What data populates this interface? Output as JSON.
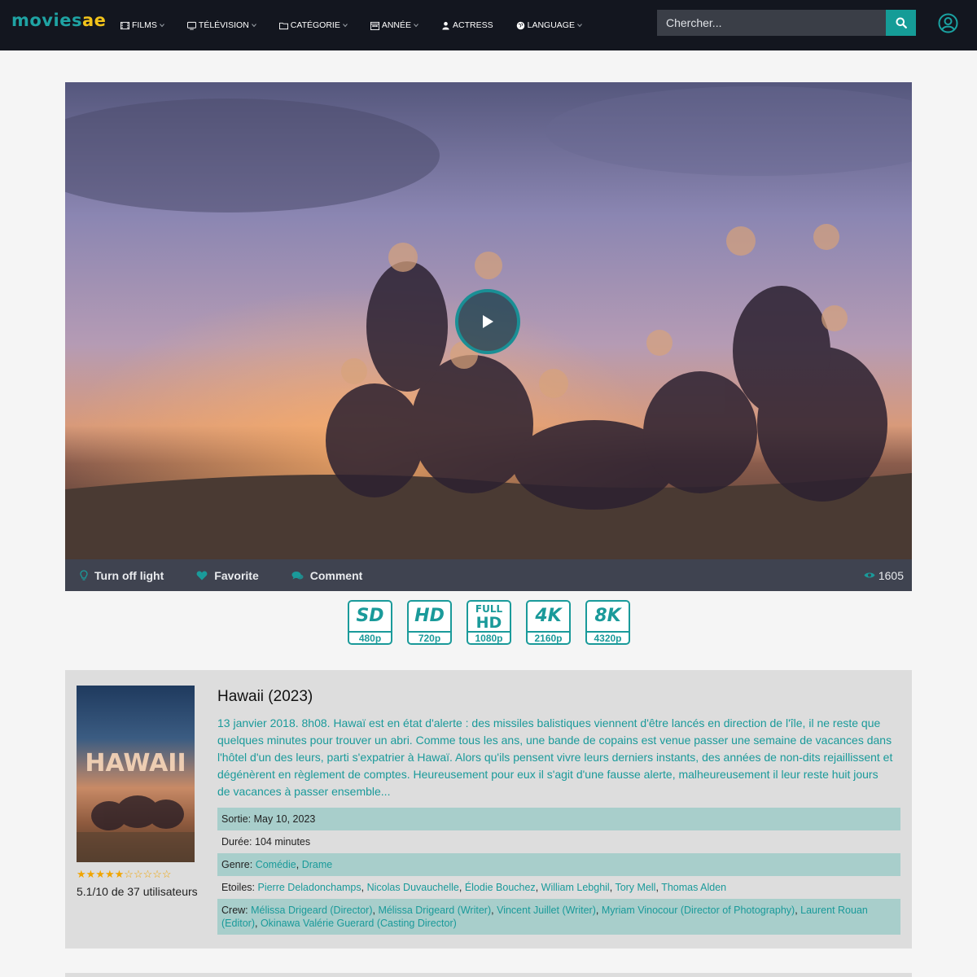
{
  "header": {
    "logo_part1": "movies",
    "logo_part2": "ae",
    "nav": [
      {
        "label": "Films",
        "icon": "film-icon"
      },
      {
        "label": "Télévision",
        "icon": "tv-icon"
      },
      {
        "label": "Catégorie",
        "icon": "folder-icon"
      },
      {
        "label": "Année",
        "icon": "calendar-icon"
      },
      {
        "label": "Actress",
        "icon": "user-icon"
      },
      {
        "label": "Language",
        "icon": "globe-icon"
      }
    ],
    "search_placeholder": "Chercher...",
    "accent": "#159c97"
  },
  "player": {
    "controls": {
      "light": "Turn off light",
      "favorite": "Favorite",
      "comment": "Comment"
    },
    "views": "1605"
  },
  "quality": [
    {
      "top": "SD",
      "res": "480p"
    },
    {
      "top": "HD",
      "res": "720p"
    },
    {
      "top_line1": "FULL",
      "top_line2": "HD",
      "res": "1080p"
    },
    {
      "top": "4K",
      "res": "2160p"
    },
    {
      "top": "8K",
      "res": "4320p"
    }
  ],
  "movie": {
    "poster_text": "HAWAII",
    "title": "Hawaii (2023)",
    "description": "13 janvier 2018. 8h08. Hawaï est en état d'alerte : des missiles balistiques viennent d'être lancés en direction de l'île, il ne reste que quelques minutes pour trouver un abri. Comme tous les ans, une bande de copains est venue passer une semaine de vacances dans l'hôtel d'un des leurs, parti s'expatrier à Hawaï. Alors qu'ils pensent vivre leurs derniers instants, des années de non-dits rejaillissent et dégénèrent en règlement de comptes. Heureusement pour eux il s'agit d'une fausse alerte, malheureusement il leur reste huit jours de vacances à passer ensemble...",
    "rating_stars": 5,
    "rating_max_stars": 10,
    "rating_text": "5.1/10 de 37 utilisateurs",
    "release_label": "Sortie:",
    "release_value": "May 10, 2023",
    "duration_label": "Durée:",
    "duration_value": "104 minutes",
    "genre_label": "Genre:",
    "genres": [
      "Comédie",
      "Drame"
    ],
    "stars_label": "Etoiles:",
    "stars": [
      "Pierre Deladonchamps",
      "Nicolas Duvauchelle",
      "Élodie Bouchez",
      "William Lebghil",
      "Tory Mell",
      "Thomas Alden"
    ],
    "crew_label": "Crew:",
    "crew": [
      "Mélissa Drigeard (Director)",
      "Mélissa Drigeard (Writer)",
      "Vincent Juillet (Writer)",
      "Myriam Vinocour (Director of Photography)",
      "Laurent Rouan (Editor)",
      "Okinawa Valérie Guerard (Casting Director)"
    ]
  }
}
